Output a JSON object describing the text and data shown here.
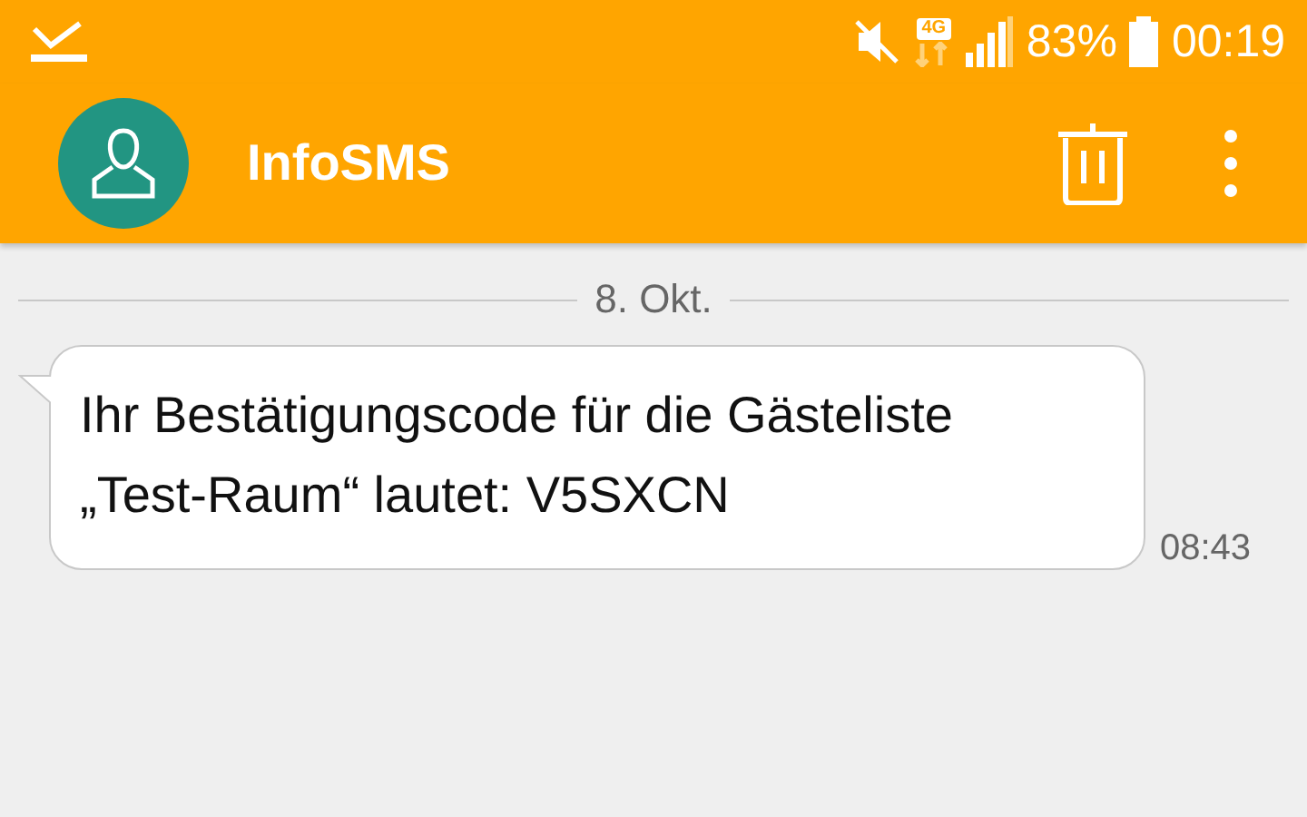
{
  "status_bar": {
    "network": "4G",
    "battery": "83%",
    "time": "00:19"
  },
  "app_bar": {
    "title": "InfoSMS"
  },
  "date_divider": "8. Okt.",
  "messages": [
    {
      "text": "Ihr Bestätigungscode für die Gästeliste\n„Test-Raum“ lautet: V5SXCN",
      "time": "08:43"
    }
  ]
}
